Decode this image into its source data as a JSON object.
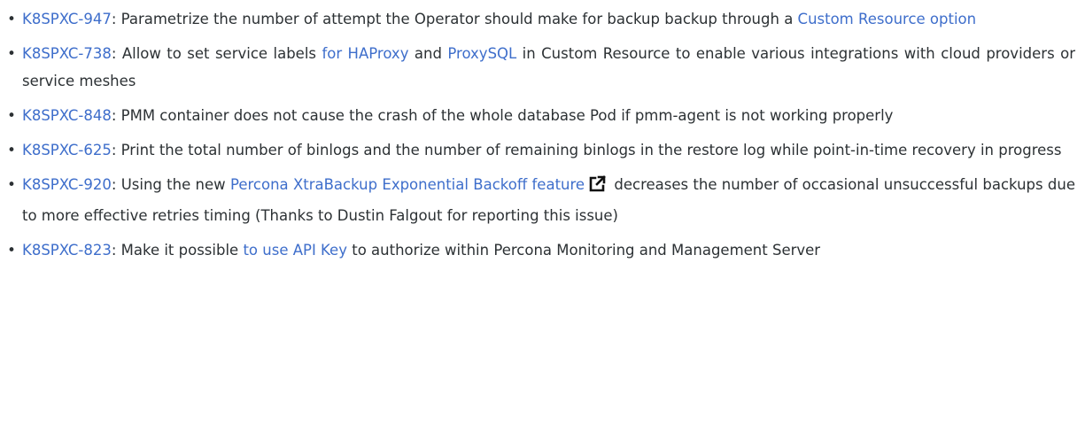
{
  "items": [
    {
      "issue": "K8SPXC-947",
      "segments": [
        {
          "text": ": Parametrize the number of attempt the Operator should make for backup backup through a "
        },
        {
          "text": "Custom Resource option",
          "link": true
        }
      ]
    },
    {
      "issue": "K8SPXC-738",
      "segments": [
        {
          "text": ": Allow to set service labels "
        },
        {
          "text": "for HAProxy",
          "link": true
        },
        {
          "text": " and "
        },
        {
          "text": "ProxySQL",
          "link": true
        },
        {
          "text": " in Custom Resource to enable various integrations with cloud providers or service meshes"
        }
      ]
    },
    {
      "issue": "K8SPXC-848",
      "segments": [
        {
          "text": ": PMM container does not cause the crash of the whole database Pod if pmm-agent is not working properly"
        }
      ]
    },
    {
      "issue": "K8SPXC-625",
      "segments": [
        {
          "text": ": Print the total number of binlogs and the number of remaining binlogs in the restore log while point-in-time recovery in progress"
        }
      ]
    },
    {
      "issue": "K8SPXC-920",
      "segments": [
        {
          "text": ": Using the new "
        },
        {
          "text": "Percona XtraBackup Exponential Backoff feature",
          "link": true,
          "external": true
        },
        {
          "text": " decreases the number of occasional unsuccessful backups due to more effective retries timing (Thanks to Dustin Falgout for reporting this issue)"
        }
      ]
    },
    {
      "issue": "K8SPXC-823",
      "segments": [
        {
          "text": ": Make it possible "
        },
        {
          "text": "to use API Key",
          "link": true
        },
        {
          "text": " to authorize within Percona Monitoring and Management Server"
        }
      ]
    }
  ],
  "bullet": "•",
  "icons": {
    "external": "external-link-icon"
  },
  "colors": {
    "link": "#3e6ecb",
    "text": "#2c3134"
  }
}
